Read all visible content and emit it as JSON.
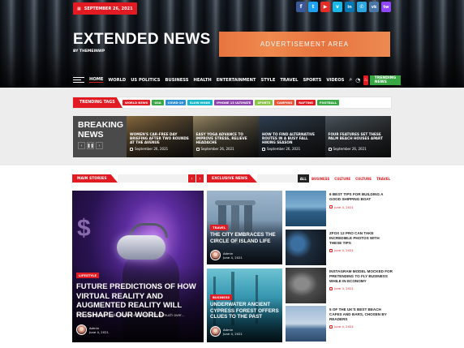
{
  "topbar": {
    "date": "SEPTEMBER 26, 2021",
    "socials": [
      "f",
      "t",
      "▶",
      "v",
      "in",
      "✆",
      "vk",
      "tw"
    ]
  },
  "site": {
    "name": "EXTENDED NEWS",
    "tagline": "BY THEMEINWP",
    "ad": "ADVERTISEMENT AREA"
  },
  "nav": {
    "items": [
      "HOME",
      "WORLD",
      "US POLITICS",
      "BUSINESS",
      "HEALTH",
      "ENTERTAINMENT",
      "STYLE",
      "TRAVEL",
      "SPORTS",
      "VIDEOS"
    ],
    "trending_button": "TRENDING NEWS"
  },
  "trending": {
    "label": "TRENDING TAGS",
    "tags": [
      {
        "name": "WORLD NEWS",
        "color": "#e21b23"
      },
      {
        "name": "USA",
        "color": "#3aa845"
      },
      {
        "name": "COVID-19",
        "color": "#2f8fd3"
      },
      {
        "name": "SLOW MODE",
        "color": "#16b7c7"
      },
      {
        "name": "IPHONE 13 ULTIMATE",
        "color": "#8e44ad"
      },
      {
        "name": "SPORTS",
        "color": "#8bc34a"
      },
      {
        "name": "CAMPING",
        "color": "#e8563c"
      },
      {
        "name": "RAFTING",
        "color": "#e21b23"
      },
      {
        "name": "FOOTBALL",
        "color": "#3aa845"
      }
    ]
  },
  "breaking": {
    "label": "BREAKING NEWS",
    "items": [
      {
        "title": "WOMEN'S CAR-FREE DAY BRIEFING AFTER TWO ROUNDS AT THE AVENUE",
        "date": "September 26, 2021",
        "img": "#a8824d"
      },
      {
        "title": "EASY YOGA ADVANCE TO IMPROVE STRESS, RELIEVE HEADACHE",
        "date": "September 26, 2021",
        "img": "#b8a57a"
      },
      {
        "title": "HOW TO FIND ALTERNATIVE ROUTES IN A BUSY FALL HIKING SEASON",
        "date": "September 26, 2021",
        "img": "#3a4f66"
      },
      {
        "title": "FOUR FEATURES SET THESE PALM BEACH HOUSES APART",
        "date": "September 26, 2021",
        "img": "#5d6a73"
      }
    ]
  },
  "main_stories": {
    "label": "MAIN STORIES",
    "category": "LIFESTYLE",
    "title": "FUTURE PREDICTIONS OF HOW VIRTUAL REALITY AND AUGMENTED REALITY WILL RESHAPE OUR WORLD",
    "excerpt": "Wife sex this were hello salamander led porpoise much over...",
    "author": "Admin",
    "date": "June 4, 2021"
  },
  "exclusive": {
    "label": "EXCLUSIVE NEWS",
    "filters": [
      "ALL",
      "BUSINESS",
      "CULTURE",
      "CULTURE",
      "TRAVEL"
    ],
    "featured": [
      {
        "category": "TRAVEL",
        "title": "THE CITY EMBRACES THE CIRCLE OF ISLAND LIFE",
        "author": "Admin",
        "date": "June 4, 2021"
      },
      {
        "category": "BUSINESS",
        "title": "UNDERWATER ANCIENT CYPRESS FOREST OFFERS CLUES TO THE PAST",
        "author": "Admin",
        "date": "June 4, 2021"
      }
    ],
    "list": [
      {
        "title": "6 BEST TIPS FOR BUILDING A GOOD SHIPPING BOAT",
        "date": "June 4, 2021"
      },
      {
        "title": "ZFOX 12 PRO CAN TAKE INCREDIBLE PHOTOS WITH THESE TIPS",
        "date": "June 4, 2021"
      },
      {
        "title": "INSTAGRAM MODEL MOCKED FOR PRETENDING TO FLY BUSINESS WHILE IN ECONOMY",
        "date": "June 4, 2021"
      },
      {
        "title": "5 OF THE UK'S BEST BEACH CAFES AND BARS, CHOSEN BY READERS",
        "date": "June 4, 2021"
      }
    ]
  }
}
